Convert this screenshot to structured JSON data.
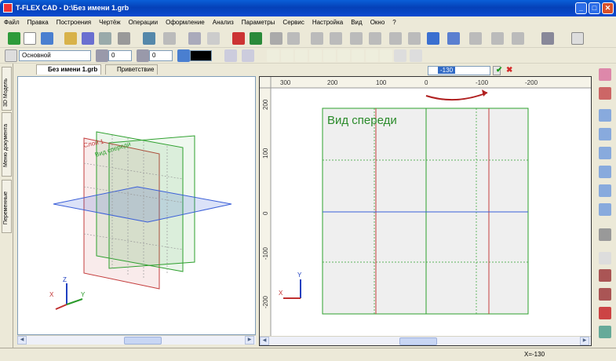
{
  "window": {
    "title": "T-FLEX CAD - D:\\Без имени 1.grb"
  },
  "menu": [
    "Файл",
    "Правка",
    "Построения",
    "Чертёж",
    "Операции",
    "Оформление",
    "Анализ",
    "Параметры",
    "Сервис",
    "Настройка",
    "Вид",
    "Окно",
    "?"
  ],
  "props": {
    "layer": "Основной",
    "v1": "0",
    "v2": "0"
  },
  "left_tabs": [
    "3D Модель",
    "Меню документа",
    "Переменные"
  ],
  "doc_tabs": [
    "Без имени 1.grb",
    "Приветствие"
  ],
  "param": {
    "value": "-130"
  },
  "view3d": {
    "label_left": "Слой 1",
    "label_front": "Вид спереди",
    "axes": {
      "x": "X",
      "y": "Y",
      "z": "Z"
    }
  },
  "view2d": {
    "title": "Вид спереди",
    "ruler_top": [
      "300",
      "200",
      "100",
      "0",
      "-100",
      "-200"
    ],
    "ruler_left": [
      "200",
      "100",
      "0",
      "-100",
      "-200"
    ],
    "axes": {
      "x": "X",
      "y": "Y"
    }
  },
  "status": {
    "coord": "X=-130"
  },
  "colors": {
    "title_bar": "#0a5fd8",
    "plane_red": "#c43c3c",
    "plane_green": "#2ea02e",
    "plane_blue": "#3a5fd8"
  }
}
